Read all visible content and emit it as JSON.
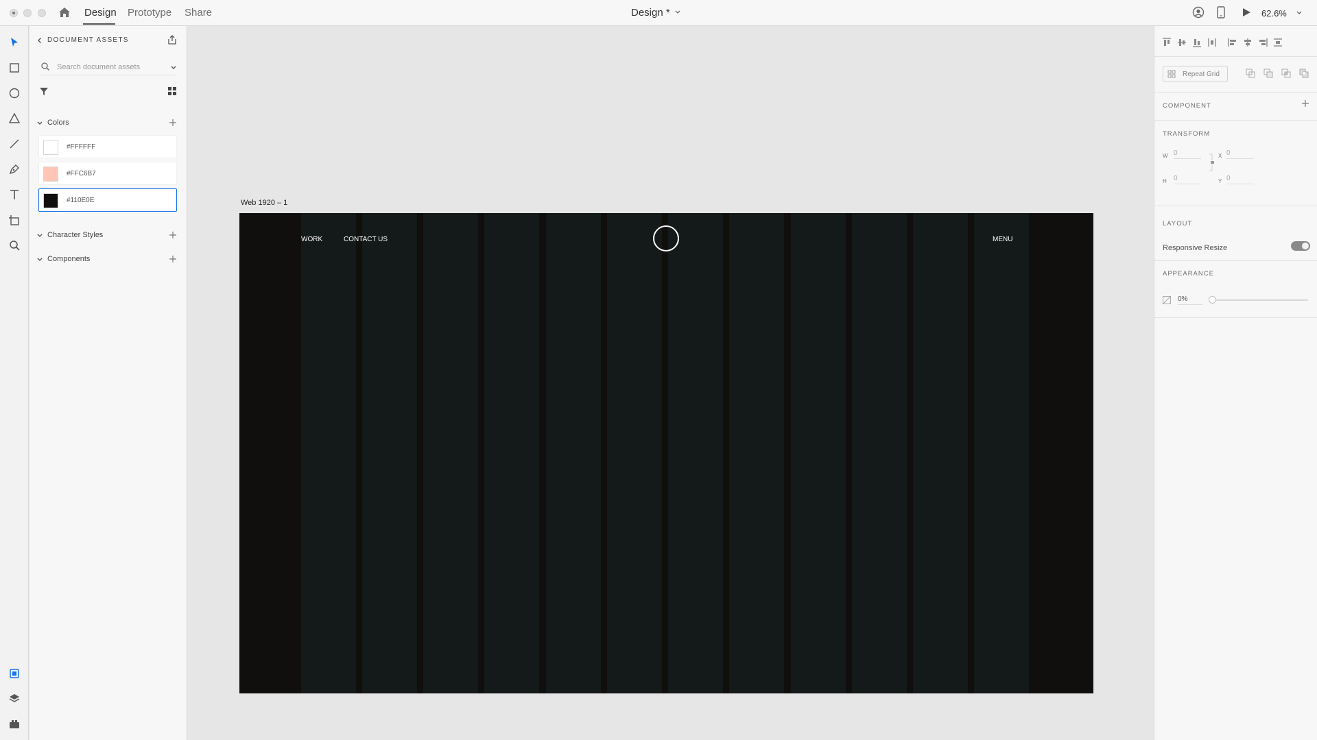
{
  "topbar": {
    "tabs": [
      {
        "label": "Design"
      },
      {
        "label": "Prototype"
      },
      {
        "label": "Share"
      }
    ],
    "document_title": "Design *",
    "zoom": "62.6%"
  },
  "assets": {
    "title": "DOCUMENT ASSETS",
    "search_placeholder": "Search document assets",
    "sections": {
      "colors": "Colors",
      "character_styles": "Character Styles",
      "components": "Components"
    },
    "colors": [
      {
        "hex_label": "#FFFFFF",
        "value": "#ffffff"
      },
      {
        "hex_label": "#FFC6B7",
        "value": "#ffc6b7"
      },
      {
        "hex_label": "#110E0E",
        "value": "#110e0e"
      }
    ]
  },
  "canvas": {
    "artboard_label": "Web 1920 – 1",
    "nav": {
      "work": "WORK",
      "contact": "CONTACT US",
      "menu": "MENU"
    }
  },
  "properties": {
    "repeat_grid": "Repeat Grid",
    "component_heading": "COMPONENT",
    "transform_heading": "TRANSFORM",
    "transform": {
      "w_label": "W",
      "w": "0",
      "h_label": "H",
      "h": "0",
      "x_label": "X",
      "x": "0",
      "y_label": "Y",
      "y": "0"
    },
    "layout_heading": "LAYOUT",
    "responsive_resize": "Responsive Resize",
    "appearance_heading": "APPEARANCE",
    "opacity": "0%"
  },
  "icons": [
    "home-icon",
    "chevron-down-icon",
    "user-icon",
    "device-icon",
    "play-icon",
    "select-tool-icon",
    "rectangle-tool-icon",
    "ellipse-tool-icon",
    "polygon-tool-icon",
    "line-tool-icon",
    "pen-tool-icon",
    "text-tool-icon",
    "artboard-tool-icon",
    "zoom-tool-icon",
    "back-icon",
    "export-icon",
    "search-icon",
    "filter-icon",
    "grid-view-icon",
    "plus-icon",
    "lock-icon",
    "layers-icon",
    "plugins-icon",
    "assets-icon"
  ]
}
